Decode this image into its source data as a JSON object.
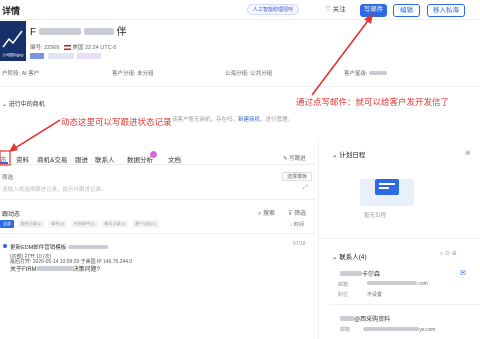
{
  "header": {
    "page_title": "详情",
    "ai_chip": "人工智能助理招呼",
    "follow": "关注",
    "buttons": {
      "write_mail": "写邮件",
      "edit": "编辑",
      "join_private_sea": "移入私海"
    }
  },
  "company": {
    "name_start": "F",
    "name_end": "伴",
    "id_label": "编号:",
    "id_value": "22969",
    "country": "美国",
    "local_time": "22:24 UTC-5",
    "logo_text": "公司图标(jpg)"
  },
  "fields": [
    {
      "label": "户阶段:",
      "value": "AI 客户"
    },
    {
      "label": "客户分组:",
      "value": "未分组"
    },
    {
      "label": "公海分组:",
      "value": "公共分组"
    },
    {
      "label": "客户星级:",
      "value": ""
    }
  ],
  "pipeline": {
    "label": "进行中的商机",
    "text": "该客户暂无商机，存在吗，",
    "link": "新建商机",
    "text_after": "，进行管理。"
  },
  "tabs": [
    {
      "label": "态",
      "active": true
    },
    {
      "label": "资料"
    },
    {
      "label": "商机&交易"
    },
    {
      "label": "跟进"
    },
    {
      "label": "联系人"
    },
    {
      "label": "数据分析"
    },
    {
      "label": "文档"
    }
  ],
  "tab_right": "写跟进",
  "filter": {
    "label": "筛选",
    "placeholder": "请输入或选择跟进记录，提示作跟进记录。",
    "button": "选择模板"
  },
  "dynamics": {
    "label": "跟动态",
    "search": "搜索",
    "filter": "筛选",
    "chips": [
      "全部",
      "跟进记录(1)",
      "邮件(0)",
      "任务邮件(0)",
      "聊天记录(0)",
      "客户动态(0)"
    ],
    "sort": "时间"
  },
  "feed_card": {
    "title_prefix": "更新EDM邮件营销模板",
    "time": "07/18",
    "line1": "(内部) 打开 10 (次)",
    "line2": "最后打开: 2026-05-14 10:59:29 于美国 IP 146.75.244.0",
    "line3_prefix": "关于FIRM",
    "line3_suffix": "决策问题?"
  },
  "right": {
    "calendar_title": "计划日程",
    "calendar_empty": "暂无日程",
    "contacts_title": "联系人(4)",
    "contact_name_suffix": "卡尔森",
    "contact_email_label": "邮箱",
    "contact_email_suffix": ".com",
    "contact_position_label": "职位",
    "contact_position_value": "不设置",
    "contact2_name": "@西采购资料",
    "contact2_email_suffix": "ye.com"
  },
  "annotations": {
    "note_mail": "通过点写邮件：就可以给客户发开发信了",
    "note_dynamics": "动态这里可以写跟进状态记录"
  },
  "colors": {
    "brand_blue": "#2d6ae3",
    "annotation_red": "#e3342f",
    "logo_navy": "#16306b",
    "badge_purple": "#d56bd2"
  }
}
